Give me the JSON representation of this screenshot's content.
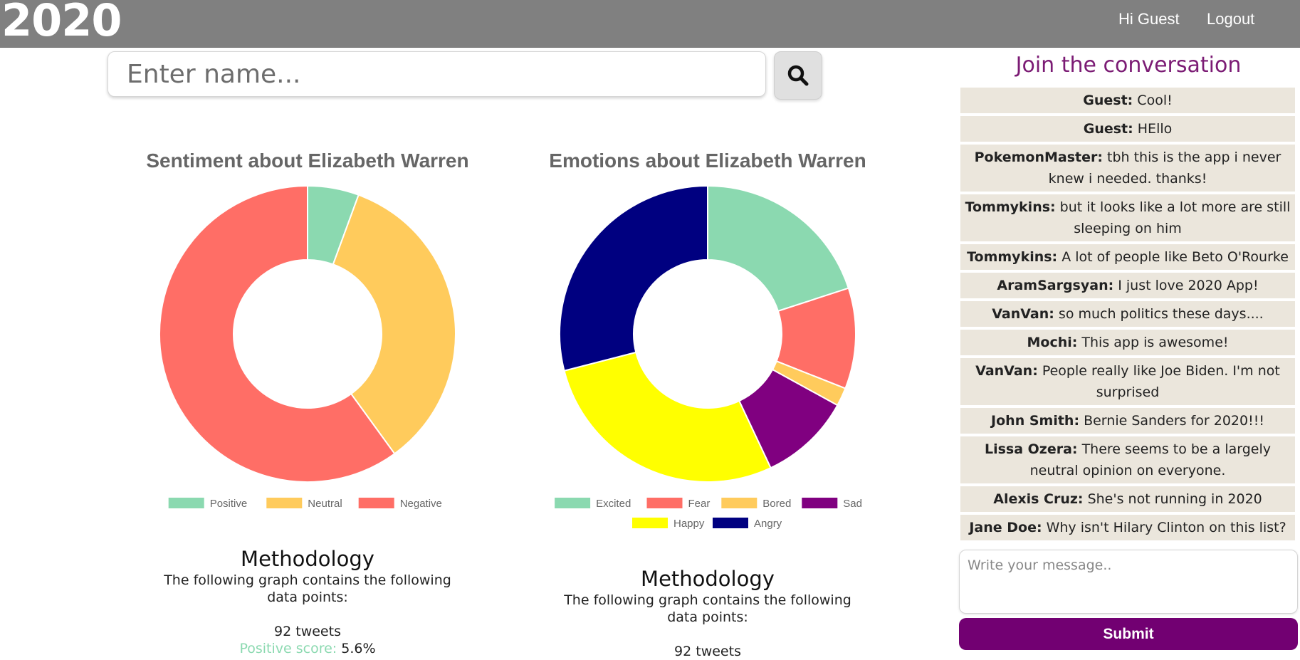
{
  "header": {
    "brand": "2020",
    "greeting": "Hi Guest",
    "logout": "Logout"
  },
  "search": {
    "placeholder": "Enter name...",
    "button_icon": "search-icon"
  },
  "sentiment_chart": {
    "title": "Sentiment about Elizabeth Warren",
    "legend": [
      "Positive",
      "Neutral",
      "Negative"
    ]
  },
  "emotions_chart": {
    "title": "Emotions about Elizabeth Warren",
    "legend": [
      "Excited",
      "Fear",
      "Bored",
      "Sad",
      "Happy",
      "Angry"
    ]
  },
  "methodology_left": {
    "heading": "Methodology",
    "line1": "The following graph contains the following",
    "line2": "data points:",
    "tweets": "92 tweets",
    "score_label": "Positive score:",
    "score_value": " 5.6%"
  },
  "methodology_right": {
    "heading": "Methodology",
    "line1": "The following graph contains the following",
    "line2": "data points:",
    "tweets": "92 tweets"
  },
  "chart_data": [
    {
      "type": "pie",
      "title": "Sentiment about Elizabeth Warren",
      "categories": [
        "Positive",
        "Neutral",
        "Negative"
      ],
      "values": [
        5.6,
        34.4,
        60.0
      ],
      "colors": [
        "#8bd9b0",
        "#ffcb5c",
        "#ff6e66"
      ],
      "legend_position": "bottom"
    },
    {
      "type": "pie",
      "title": "Emotions about Elizabeth Warren",
      "categories": [
        "Excited",
        "Fear",
        "Bored",
        "Sad",
        "Happy",
        "Angry"
      ],
      "values": [
        20,
        11,
        2,
        10,
        28,
        29
      ],
      "colors": [
        "#8bd9b0",
        "#ff6e66",
        "#ffcb5c",
        "#800080",
        "#ffff00",
        "#000080"
      ],
      "legend_position": "bottom"
    }
  ],
  "chat": {
    "title": "Join the conversation",
    "messages": [
      {
        "user": "Guest:",
        "text": " Cool!"
      },
      {
        "user": "Guest:",
        "text": " HEllo"
      },
      {
        "user": "PokemonMaster:",
        "text": " tbh this is the app i never knew i needed. thanks!"
      },
      {
        "user": "Tommykins:",
        "text": " but it looks like a lot more are still sleeping on him"
      },
      {
        "user": "Tommykins:",
        "text": " A lot of people like Beto O'Rourke"
      },
      {
        "user": "AramSargsyan:",
        "text": " I just love 2020 App!"
      },
      {
        "user": "VanVan:",
        "text": " so much politics these days...."
      },
      {
        "user": "Mochi:",
        "text": " This app is awesome!"
      },
      {
        "user": "VanVan:",
        "text": " People really like Joe Biden. I'm not surprised"
      },
      {
        "user": "John Smith:",
        "text": " Bernie Sanders for 2020!!!"
      },
      {
        "user": "Lissa Ozera:",
        "text": " There seems to be a largely neutral opinion on everyone."
      },
      {
        "user": "Alexis Cruz:",
        "text": " She's not running in 2020"
      },
      {
        "user": "Jane Doe:",
        "text": " Why isn't Hilary Clinton on this list?"
      }
    ],
    "input_placeholder": "Write your message..",
    "submit": "Submit"
  }
}
